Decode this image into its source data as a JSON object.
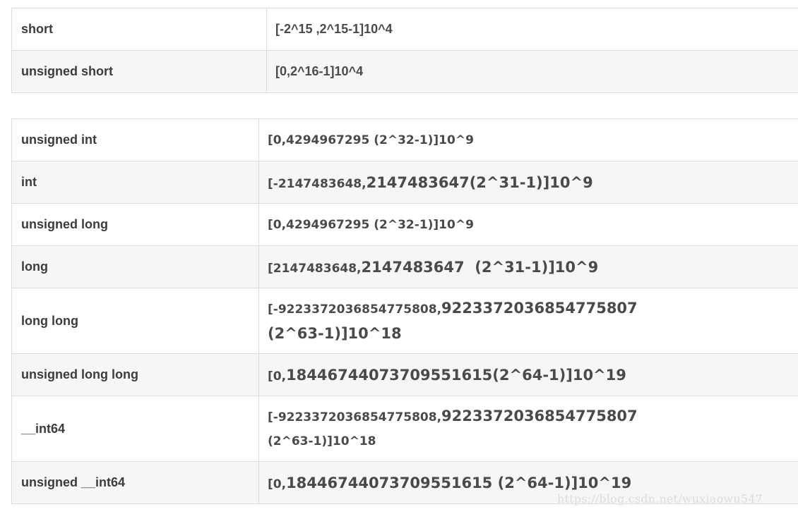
{
  "table1": {
    "rows": [
      {
        "type": "short",
        "range": "[-2^15 ,2^15-1]10^4"
      },
      {
        "type": "unsigned short",
        "range": "[0,2^16-1]10^4"
      }
    ]
  },
  "table2": {
    "rows": [
      {
        "type": "unsigned int",
        "range": "[0,4294967295 (2^32-1)]10^9"
      },
      {
        "type": "int",
        "range_a": "[-2147483648,",
        "range_b": "2147483647(2^31-1)]10^9"
      },
      {
        "type": "unsigned long",
        "range": "[0,4294967295 (2^32-1)]10^9"
      },
      {
        "type": "long",
        "range_a": "[2147483648,",
        "range_b": "2147483647  (2^31-1)]10^9"
      },
      {
        "type": "long long",
        "range_a": "[-9223372036854775808,",
        "range_b": "9223372036854775807",
        "range_c": "(2^63-1)]10^18"
      },
      {
        "type": "unsigned long long",
        "range_a": "[0,",
        "range_b": "18446744073709551615(2^64-1)]10^19"
      },
      {
        "type": "__int64",
        "range_a": "[-9223372036854775808,",
        "range_b": "9223372036854775807",
        "range_c": "(2^63-1)]10^18"
      },
      {
        "type": "unsigned __int64",
        "range_a": "[0,",
        "range_b": "18446744073709551615 (2^64-1)]10^19"
      }
    ]
  },
  "watermark": "https://blog.csdn.net/wuxiaowu547"
}
